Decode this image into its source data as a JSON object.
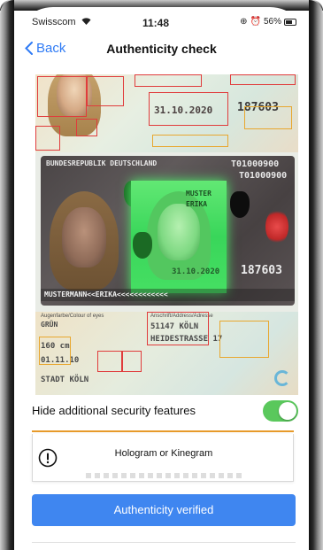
{
  "status_bar": {
    "carrier": "Swisscom",
    "time": "11:48",
    "battery": "56%"
  },
  "nav": {
    "back_label": "Back",
    "title": "Authenticity check"
  },
  "document": {
    "top_date": "31.10.2020",
    "top_number": "187603",
    "header": "BUNDESREPUBLIK DEUTSCHLAND",
    "doc_number_1": "T01000900",
    "doc_number_2": "T01000900",
    "photo_name_1": "MUSTER",
    "photo_name_2": "ERIKA",
    "card_date": "31.10.2020",
    "card_number": "187603",
    "mrz_text": "MUSTERMANN<<ERIKA<<<<<<<<<<<<",
    "back_eye_color_label": "Augenfarbe/Colour of eyes",
    "back_eye_color": "GRÜN",
    "back_height": "160 cm",
    "back_date": "01.11.10",
    "back_city_issued": "STADT KÖLN",
    "back_address_label": "Anschrift/Address/Adresse",
    "back_address_1": "51147 KÖLN",
    "back_address_2": "HEIDESTRASSE 17"
  },
  "toggle": {
    "label": "Hide additional security features",
    "on": true
  },
  "feature": {
    "label": "Hologram or Kinegram",
    "icon": "warning-icon"
  },
  "button": {
    "label": "Authenticity verified"
  },
  "colors": {
    "accent": "#3f86f0",
    "link": "#2f7bf5",
    "toggle_on": "#5ac85c",
    "highlight_red": "#e03c3c",
    "highlight_yellow": "#e8a72f"
  }
}
